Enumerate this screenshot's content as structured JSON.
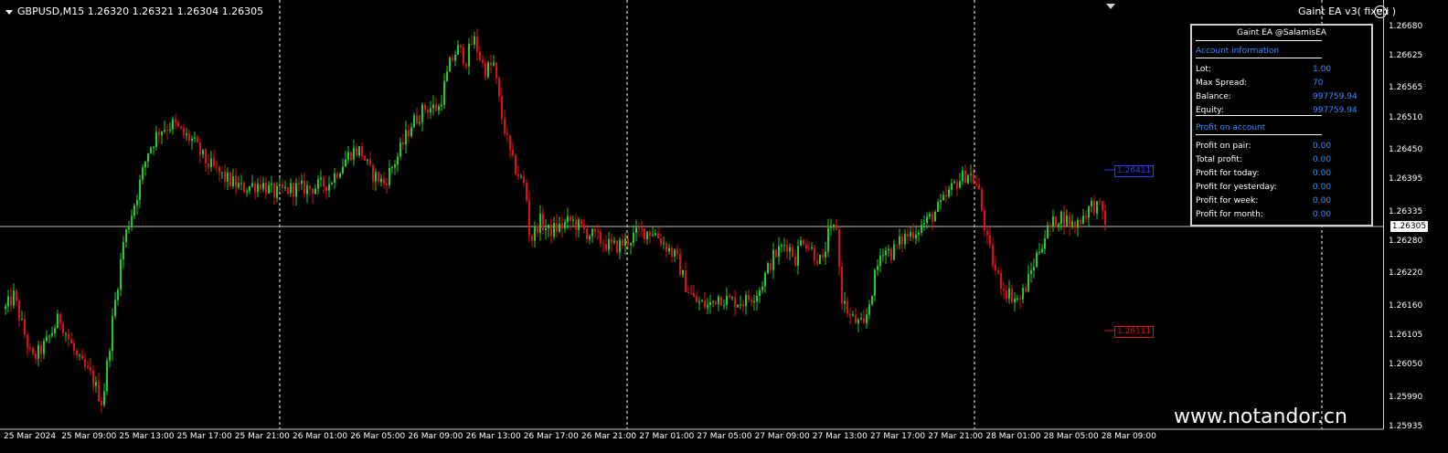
{
  "header": {
    "symbol_info": "GBPUSD,M15  1.26320 1.26321 1.26304 1.26305",
    "ea_label": "Gaint  EA  v3( fixed )"
  },
  "panel": {
    "title": "Gaint EA @SalamisEA",
    "account_section": "Account information",
    "lot_label": "Lot:",
    "lot_value": "1.00",
    "spread_label": "Max Spread:",
    "spread_value": "70",
    "balance_label": "Balance:",
    "balance_value": "997759.94",
    "equity_label": "Equity:",
    "equity_value": "997759.94",
    "profit_section": "Profit on account",
    "profit_pair_label": "Profit on pair:",
    "profit_pair_value": "0.00",
    "total_profit_label": "Total profit:",
    "total_profit_value": "0.00",
    "profit_today_label": "Profit for today:",
    "profit_today_value": "0.00",
    "profit_yesterday_label": "Profit for yesterday:",
    "profit_yesterday_value": "0.00",
    "profit_week_label": "Profit for week:",
    "profit_week_value": "0.00",
    "profit_month_label": "Profit for month:",
    "profit_month_value": "0.00"
  },
  "price_axis": {
    "ticks": [
      "1.26680",
      "1.26625",
      "1.26565",
      "1.26510",
      "1.26450",
      "1.26395",
      "1.26335",
      "1.26280",
      "1.26220",
      "1.26160",
      "1.26105",
      "1.26050",
      "1.25990",
      "1.25935"
    ],
    "current_price": "1.26305"
  },
  "levels": {
    "upper": "1.26411",
    "lower": "1.26111"
  },
  "time_axis": {
    "labels": [
      "25 Mar 2024",
      "25 Mar 09:00",
      "25 Mar 13:00",
      "25 Mar 17:00",
      "25 Mar 21:00",
      "26 Mar 01:00",
      "26 Mar 05:00",
      "26 Mar 09:00",
      "26 Mar 13:00",
      "26 Mar 17:00",
      "26 Mar 21:00",
      "27 Mar 01:00",
      "27 Mar 05:00",
      "27 Mar 09:00",
      "27 Mar 13:00",
      "27 Mar 17:00",
      "27 Mar 21:00",
      "28 Mar 01:00",
      "28 Mar 05:00",
      "28 Mar 09:00"
    ]
  },
  "watermark": "www.notandor.cn",
  "colors": {
    "background": "#000000",
    "bull_candle": "#22cc22",
    "bear_candle": "#e01010",
    "upper_level": "#2a3cff",
    "lower_level": "#e01010",
    "panel_accent": "#3a8cff"
  },
  "chart_data": {
    "type": "candlestick",
    "symbol": "GBPUSD",
    "timeframe": "M15",
    "ylim": [
      1.25935,
      1.267
    ],
    "path": [
      [
        0,
        1.2614
      ],
      [
        15,
        1.2618
      ],
      [
        35,
        1.2606
      ],
      [
        50,
        1.2609
      ],
      [
        65,
        1.2614
      ],
      [
        85,
        1.2606
      ],
      [
        100,
        1.2603
      ],
      [
        112,
        1.2598
      ],
      [
        122,
        1.2612
      ],
      [
        135,
        1.2628
      ],
      [
        150,
        1.2637
      ],
      [
        162,
        1.2645
      ],
      [
        175,
        1.2649
      ],
      [
        190,
        1.265
      ],
      [
        200,
        1.2648
      ],
      [
        210,
        1.2647
      ],
      [
        225,
        1.2643
      ],
      [
        245,
        1.264
      ],
      [
        265,
        1.2638
      ],
      [
        285,
        1.2639
      ],
      [
        300,
        1.2637
      ],
      [
        320,
        1.2638
      ],
      [
        340,
        1.2638
      ],
      [
        360,
        1.2639
      ],
      [
        372,
        1.2642
      ],
      [
        385,
        1.2645
      ],
      [
        395,
        1.2645
      ],
      [
        405,
        1.2641
      ],
      [
        420,
        1.2639
      ],
      [
        435,
        1.2644
      ],
      [
        450,
        1.265
      ],
      [
        465,
        1.2653
      ],
      [
        480,
        1.2653
      ],
      [
        492,
        1.2661
      ],
      [
        500,
        1.2664
      ],
      [
        510,
        1.2662
      ],
      [
        518,
        1.2666
      ],
      [
        530,
        1.266
      ],
      [
        540,
        1.2661
      ],
      [
        548,
        1.2652
      ],
      [
        560,
        1.2643
      ],
      [
        575,
        1.2638
      ],
      [
        580,
        1.2628
      ],
      [
        590,
        1.2632
      ],
      [
        600,
        1.263
      ],
      [
        615,
        1.2631
      ],
      [
        625,
        1.2632
      ],
      [
        640,
        1.263
      ],
      [
        660,
        1.2628
      ],
      [
        670,
        1.2627
      ],
      [
        685,
        1.2628
      ],
      [
        700,
        1.263
      ],
      [
        715,
        1.263
      ],
      [
        730,
        1.2627
      ],
      [
        740,
        1.2625
      ],
      [
        750,
        1.262
      ],
      [
        760,
        1.2617
      ],
      [
        775,
        1.2616
      ],
      [
        785,
        1.2618
      ],
      [
        800,
        1.2617
      ],
      [
        815,
        1.2617
      ],
      [
        830,
        1.2619
      ],
      [
        845,
        1.2625
      ],
      [
        860,
        1.2628
      ],
      [
        870,
        1.2625
      ],
      [
        878,
        1.2629
      ],
      [
        890,
        1.2626
      ],
      [
        900,
        1.2624
      ],
      [
        905,
        1.2629
      ],
      [
        915,
        1.2631
      ],
      [
        920,
        1.2618
      ],
      [
        930,
        1.2614
      ],
      [
        945,
        1.2612
      ],
      [
        955,
        1.262
      ],
      [
        965,
        1.2627
      ],
      [
        975,
        1.2626
      ],
      [
        990,
        1.2629
      ],
      [
        1000,
        1.263
      ],
      [
        1015,
        1.2632
      ],
      [
        1030,
        1.2635
      ],
      [
        1045,
        1.2639
      ],
      [
        1060,
        1.2641
      ],
      [
        1070,
        1.2638
      ],
      [
        1080,
        1.2628
      ],
      [
        1090,
        1.2622
      ],
      [
        1100,
        1.2619
      ],
      [
        1115,
        1.2617
      ],
      [
        1125,
        1.2621
      ],
      [
        1135,
        1.2626
      ],
      [
        1145,
        1.263
      ],
      [
        1160,
        1.2633
      ],
      [
        1175,
        1.2631
      ],
      [
        1185,
        1.2633
      ],
      [
        1195,
        1.2635
      ],
      [
        1205,
        1.2634
      ],
      [
        1212,
        1.26305
      ]
    ]
  }
}
